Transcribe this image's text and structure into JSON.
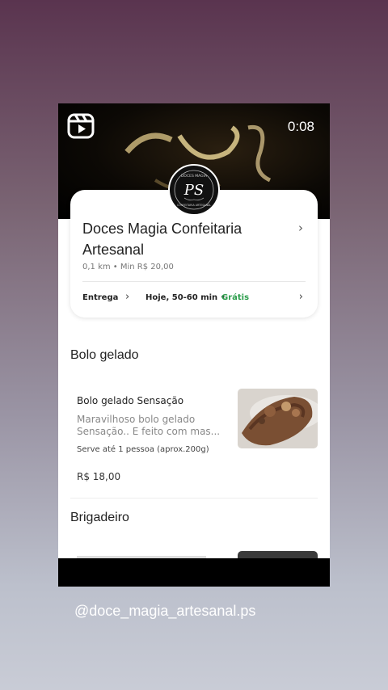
{
  "overlay": {
    "timer": "0:08",
    "handle": "@doce_magia_artesanal.ps"
  },
  "store": {
    "name": "Doces Magia Confeitaria Artesanal",
    "meta": "0,1 km • Min R$ 20,00",
    "logo_text": "PS",
    "logo_ring_top": "DOCES MAGIA",
    "logo_ring_bottom": "CONFEITARIA ARTESANAL",
    "delivery": {
      "label": "Entrega",
      "time": "Hoje, 50-60 min •",
      "fee": "Grátis"
    }
  },
  "sections": [
    {
      "title": "Bolo gelado",
      "item": {
        "name": "Bolo gelado Sensação",
        "description": "Maravilhoso bolo gelado Sensação.. E feito com mas...",
        "serves": "Serve até 1 pessoa (aprox.200g)",
        "price": "R$ 18,00"
      }
    },
    {
      "title": "Brigadeiro"
    }
  ],
  "colors": {
    "free_delivery": "#2a9d4a",
    "text": "#222222"
  },
  "icons": [
    "instagram-reels-icon",
    "chevron-right-icon"
  ]
}
